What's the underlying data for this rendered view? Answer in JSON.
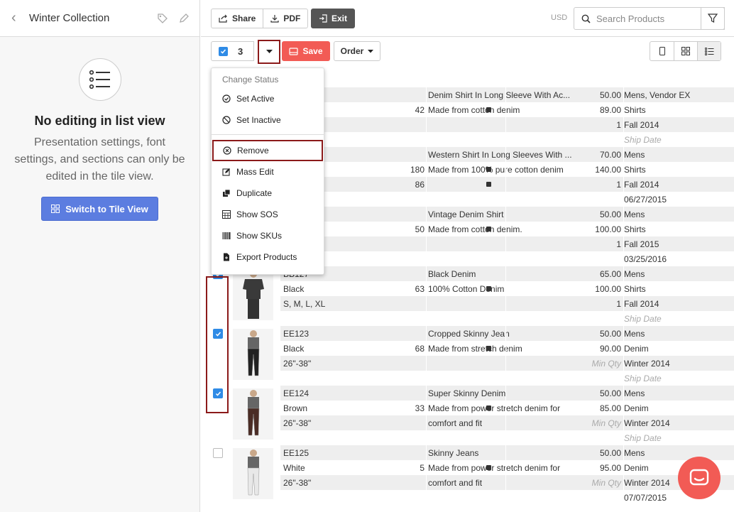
{
  "sidebar": {
    "title": "Winter Collection",
    "empty_title": "No editing in list view",
    "empty_desc": "Presentation settings, font settings, and sections can only be edited in the tile view.",
    "switch_label": "Switch to Tile View"
  },
  "toolbar": {
    "share": "Share",
    "pdf": "PDF",
    "exit": "Exit",
    "currency": "USD",
    "search_placeholder": "Search Products"
  },
  "subbar": {
    "selected_count": "3",
    "save": "Save",
    "order": "Order"
  },
  "menu": {
    "header": "Change Status",
    "set_active": "Set Active",
    "set_inactive": "Set Inactive",
    "remove": "Remove",
    "mass_edit": "Mass Edit",
    "duplicate": "Duplicate",
    "show_sos": "Show SOS",
    "show_skus": "Show SKUs",
    "export": "Export Products"
  },
  "rows": [
    {
      "lines": [
        {
          "c1": "",
          "c2": "",
          "c3": "Denim Shirt In Long Sleeve With Ac...",
          "c4": "50.00",
          "c5": "Mens, Vendor EX"
        },
        {
          "c1": "",
          "c2": "42",
          "c3": "Made from cotton denim",
          "c4": "89.00",
          "c5": "Shirts"
        },
        {
          "c1": "",
          "c2": "",
          "c3": "",
          "c4": "1",
          "c5": "Fall 2014"
        },
        {
          "c1": "",
          "c2": "",
          "c3": "",
          "c4": "",
          "c5": "Ship Date"
        }
      ]
    },
    {
      "lines": [
        {
          "c1": "",
          "c2": "",
          "c3": "Western Shirt In Long Sleeves With ...",
          "c4": "70.00",
          "c5": "Mens"
        },
        {
          "c1": "",
          "c2": "180",
          "c3": "Made from 100% pure cotton denim",
          "c4": "140.00",
          "c5": "Shirts"
        },
        {
          "c1": "",
          "c2": "86",
          "c3": "",
          "c4": "1",
          "c5": "Fall 2014"
        },
        {
          "c1": "",
          "c2": "",
          "c3": "",
          "c4": "",
          "c5": "06/27/2015"
        }
      ]
    },
    {
      "lines": [
        {
          "c1": "",
          "c2": "",
          "c3": "Vintage Denim Shirt",
          "c4": "50.00",
          "c5": "Mens"
        },
        {
          "c1": "",
          "c2": "50",
          "c3": "Made from cotton denim.",
          "c4": "100.00",
          "c5": "Shirts"
        },
        {
          "c1": "",
          "c2": "",
          "c3": "",
          "c4": "1",
          "c5": "Fall 2015"
        },
        {
          "c1": "",
          "c2": "",
          "c3": "",
          "c4": "",
          "c5": "03/25/2016"
        }
      ]
    },
    {
      "checked": true,
      "lines": [
        {
          "c1": "BB127",
          "c2": "",
          "c3": "Black Denim",
          "c4": "65.00",
          "c5": "Mens"
        },
        {
          "c1": "Black",
          "c2": "63",
          "c3": "100% Cotton Denim",
          "c4": "100.00",
          "c5": "Shirts"
        },
        {
          "c1": "S, M, L, XL",
          "c2": "",
          "c3": "",
          "c4": "1",
          "c5": "Fall 2014"
        },
        {
          "c1": "",
          "c2": "",
          "c3": "",
          "c4": "",
          "c5": "Ship Date"
        }
      ]
    },
    {
      "checked": true,
      "lines": [
        {
          "c1": "EE123",
          "c2": "",
          "c3": "Cropped Skinny Jean",
          "c4": "50.00",
          "c5": "Mens"
        },
        {
          "c1": "Black",
          "c2": "68",
          "c3": "Made from stretch denim",
          "c4": "90.00",
          "c5": "Denim"
        },
        {
          "c1": "26\"-38\"",
          "c2": "",
          "c3": "",
          "c4": "Min Qty",
          "c5": "Winter 2014"
        },
        {
          "c1": "",
          "c2": "",
          "c3": "",
          "c4": "",
          "c5": "Ship Date"
        }
      ]
    },
    {
      "checked": true,
      "lines": [
        {
          "c1": "EE124",
          "c2": "",
          "c3": "Super Skinny Denim",
          "c4": "50.00",
          "c5": "Mens"
        },
        {
          "c1": "Brown",
          "c2": "33",
          "c3": "Made from power stretch denim for",
          "c4": "85.00",
          "c5": "Denim"
        },
        {
          "c1": "26\"-38\"",
          "c2": "",
          "c3": "comfort and fit",
          "c4": "Min Qty",
          "c5": "Winter 2014"
        },
        {
          "c1": "",
          "c2": "",
          "c3": "",
          "c4": "",
          "c5": "Ship Date"
        }
      ]
    },
    {
      "checked": false,
      "lines": [
        {
          "c1": "EE125",
          "c2": "",
          "c3": "Skinny Jeans",
          "c4": "50.00",
          "c5": "Mens"
        },
        {
          "c1": "White",
          "c2": "5",
          "c3": "Made from power stretch denim for",
          "c4": "95.00",
          "c5": "Denim"
        },
        {
          "c1": "26\"-38\"",
          "c2": "",
          "c3": "comfort and fit",
          "c4": "Min Qty",
          "c5": "Winter 2014"
        },
        {
          "c1": "",
          "c2": "",
          "c3": "",
          "c4": "",
          "c5": "07/07/2015"
        }
      ]
    }
  ],
  "colors": {
    "accent": "#5c7de0",
    "save": "#f25b55",
    "check": "#2f8be6",
    "highlight": "#8b1a1a"
  }
}
